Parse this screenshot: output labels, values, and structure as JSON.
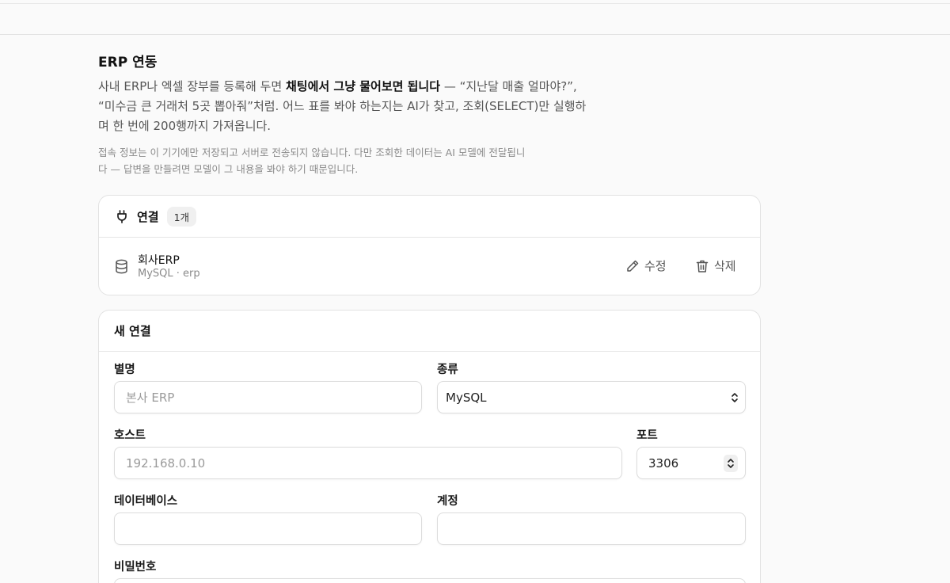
{
  "header": {
    "title": "ERP 연동",
    "desc_before": "사내 ERP나 엑셀 장부를 등록해 두면 ",
    "desc_bold": "채팅에서 그냥 물어보면 됩니다",
    "desc_after": " — “지난달 매출 얼마야?”, “미수금 큰 거래처 5곳 뽑아줘”처럼. 어느 표를 봐야 하는지는 AI가 찾고, 조회(SELECT)만 실행하며 한 번에 200행까지 가져옵니다.",
    "note": "접속 정보는 이 기기에만 저장되고 서버로 전송되지 않습니다. 다만 조회한 데이터는 AI 모델에 전달됩니다 — 답변을 만들려면 모델이 그 내용을 봐야 하기 때문입니다."
  },
  "connections": {
    "label": "연결",
    "count": "1개",
    "items": [
      {
        "name": "회사ERP",
        "detail": "MySQL · erp",
        "edit_label": "수정",
        "delete_label": "삭제"
      }
    ]
  },
  "new_connection": {
    "title": "새 연결",
    "alias_label": "별명",
    "alias_placeholder": "본사 ERP",
    "type_label": "종류",
    "type_value": "MySQL",
    "host_label": "호스트",
    "host_placeholder": "192.168.0.10",
    "port_label": "포트",
    "port_value": "3306",
    "database_label": "데이터베이스",
    "account_label": "계정",
    "password_label": "비밀번호"
  },
  "icons": [
    "plug-icon",
    "database-icon",
    "pencil-icon",
    "trash-icon",
    "updown-chevron-icon"
  ]
}
